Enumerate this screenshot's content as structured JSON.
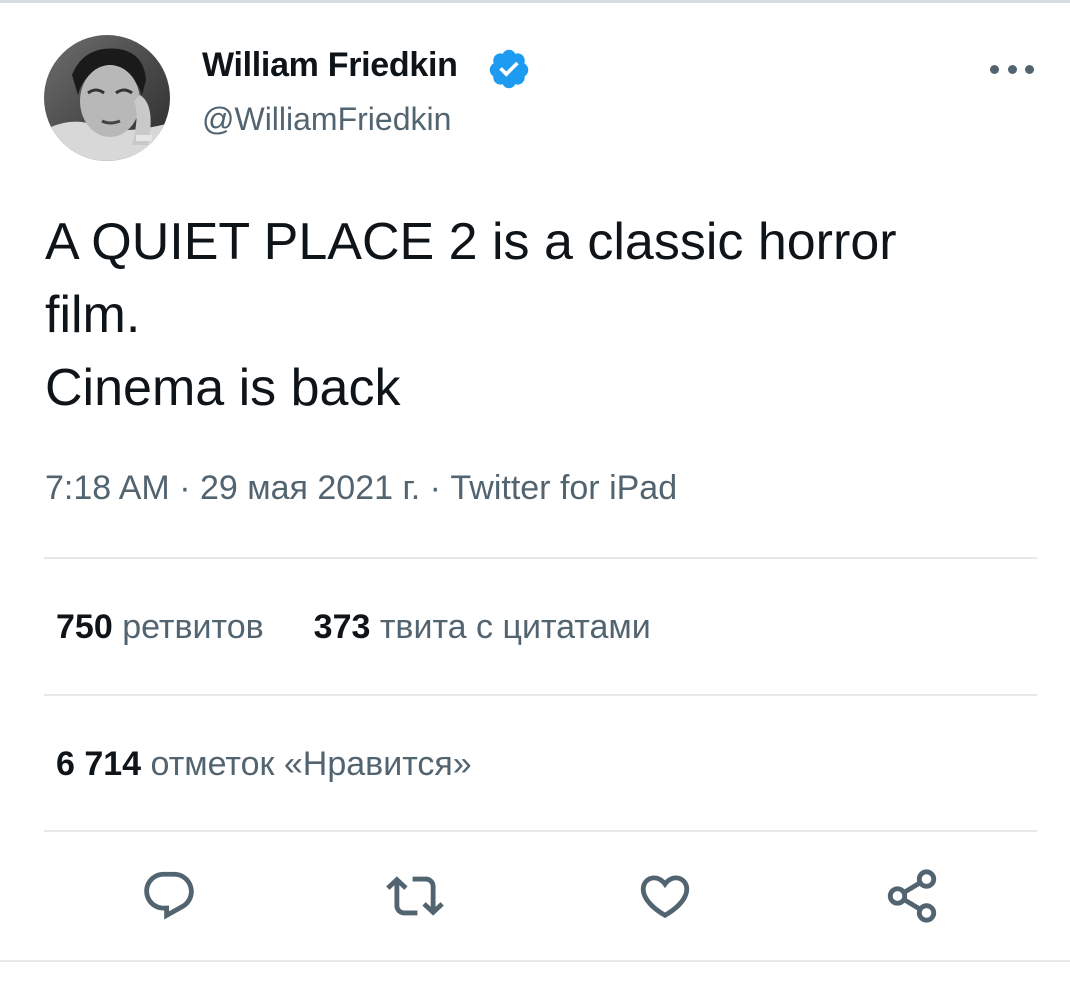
{
  "tweet": {
    "author": {
      "name": "William Friedkin",
      "handle": "@WilliamFriedkin",
      "verified": true,
      "avatar_icon": "author-photo"
    },
    "text_lines": [
      "A QUIET PLACE 2 is a classic horror",
      "film.",
      "Cinema is back"
    ],
    "meta": {
      "time": "7:18 AM",
      "separator": " · ",
      "date": "29 мая 2021 г.",
      "source": "Twitter for iPad"
    },
    "stats": {
      "retweets": {
        "count": "750",
        "label": "ретвитов"
      },
      "quotes": {
        "count": "373",
        "label": "твита с цитатами"
      },
      "likes": {
        "count": "6 714",
        "label": "отметок «Нравится»"
      }
    },
    "actions": [
      "reply-icon",
      "retweet-icon",
      "like-icon",
      "share-icon"
    ]
  },
  "colors": {
    "text_primary": "#0f1419",
    "text_secondary": "#536471",
    "verified_badge": "#1d9bf0",
    "divider": "#e6e9eb"
  }
}
